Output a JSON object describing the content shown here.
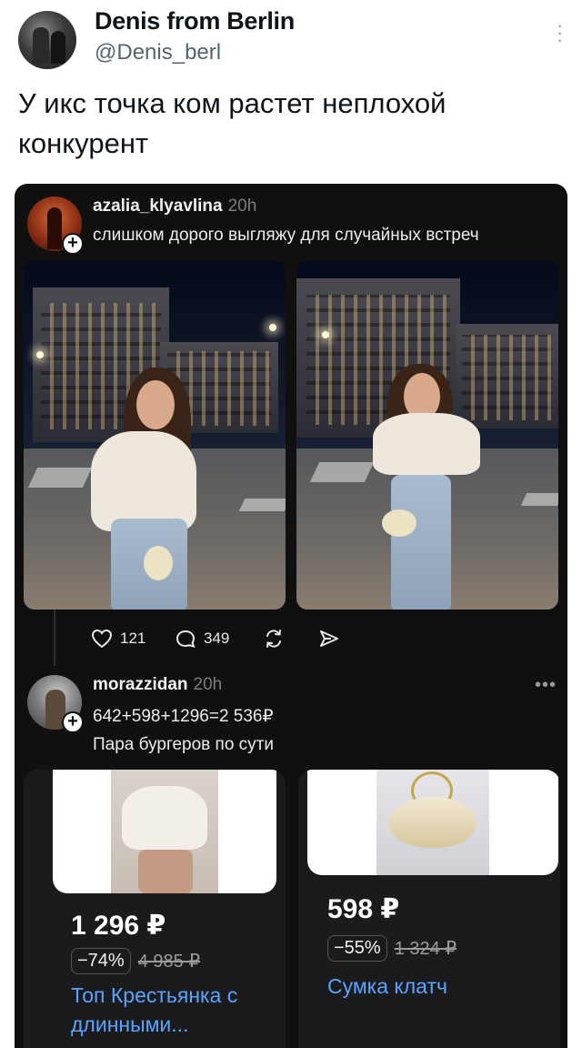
{
  "tweet": {
    "author_name": "Denis from Berlin",
    "author_handle": "@Denis_berl",
    "text": "У икс точка ком растет неплохой конкурент"
  },
  "embedded": {
    "post1": {
      "username": "azalia_klyavlina",
      "time": "20h",
      "text": "слишком дорого выгляжу для случайных встреч",
      "likes": "121",
      "comments": "349"
    },
    "post2": {
      "username": "morazzidan",
      "time": "20h",
      "line1": "642+598+1296=2 536₽",
      "line2": "Пара бургеров по сути"
    },
    "products": [
      {
        "price": "1 296 ₽",
        "discount": "−74%",
        "old_price": "4 985 ₽",
        "name": "Топ Крестьянка с длинными..."
      },
      {
        "price": "598 ₽",
        "discount": "−55%",
        "old_price": "1 324 ₽",
        "name": "Сумка клатч"
      }
    ]
  },
  "icons": {
    "more": "more-vertical-icon",
    "like": "heart-icon",
    "comment": "comment-bubble-icon",
    "repost": "repost-icon",
    "share": "send-icon",
    "follow": "plus-icon"
  },
  "colors": {
    "embedded_bg": "#101010",
    "link_blue": "#5aa3ff",
    "handle_gray": "#536471"
  }
}
